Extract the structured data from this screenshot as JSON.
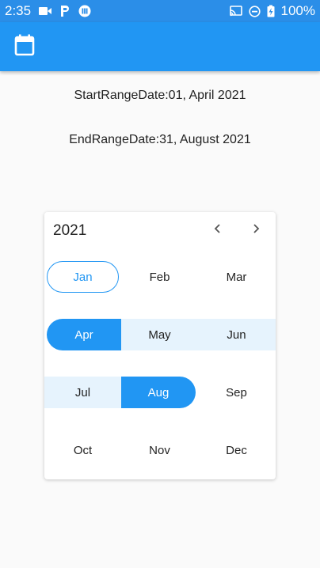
{
  "status_bar": {
    "time": "2:35",
    "battery": "100%",
    "left_icons": [
      "video-camera-icon",
      "parking-icon",
      "app-notification-icon"
    ],
    "right_icons": [
      "cast-icon",
      "do-not-disturb-icon",
      "battery-charging-icon"
    ]
  },
  "app_bar": {
    "icon": "calendar-icon",
    "color": "#2196f3"
  },
  "range": {
    "start_text": "StartRangeDate:01, April 2021",
    "end_text": "EndRangeDate:31, August 2021"
  },
  "picker": {
    "year": "2021",
    "prev_icon": "chevron-left-icon",
    "next_icon": "chevron-right-icon",
    "accent": "#2196f3",
    "range_fill": "#e6f3fd",
    "months": [
      "Jan",
      "Feb",
      "Mar",
      "Apr",
      "May",
      "Jun",
      "Jul",
      "Aug",
      "Sep",
      "Oct",
      "Nov",
      "Dec"
    ],
    "today_month": "Jan",
    "range_start_month": "Apr",
    "range_end_month": "Aug"
  }
}
